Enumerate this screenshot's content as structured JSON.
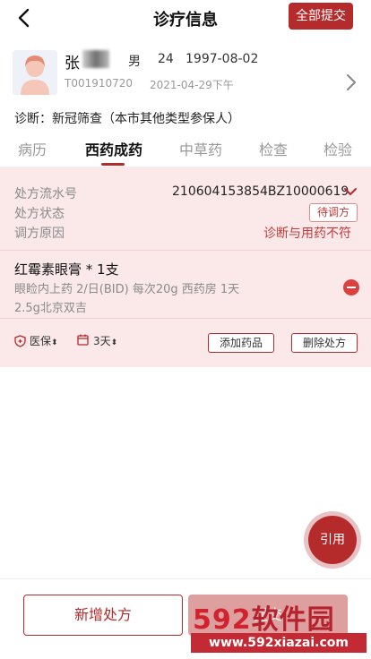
{
  "header": {
    "title": "诊疗信息",
    "submit_all_label": "全部提交"
  },
  "patient": {
    "name": "张",
    "gender": "男",
    "age": "24",
    "birthdate": "1997-08-02",
    "patient_id": "T001910720",
    "visit_time": "2021-04-29下午"
  },
  "diagnosis": {
    "text": "诊断：新冠筛查（本市其他类型参保人）"
  },
  "tabs": [
    {
      "label": "病历"
    },
    {
      "label": "西药成药"
    },
    {
      "label": "中草药"
    },
    {
      "label": "检查"
    },
    {
      "label": "检验"
    }
  ],
  "active_tab": "西药成药",
  "prescription": {
    "serial_label": "处方流水号",
    "serial_value": "210604153854BZ10000619",
    "status_label": "处方状态",
    "status_value": "待调方",
    "reason_label": "调方原因",
    "reason_value": "诊断与用药不符",
    "drug": {
      "name": "红霉素眼膏 * 1支",
      "detail_line1": "眼睑内上药 2/日(BID) 每次20g 西药房 1天",
      "detail_line2": "2.5g北京双吉"
    },
    "insurance_label": "医保",
    "days_label": "3天",
    "add_drug_label": "添加药品",
    "delete_rx_label": "删除处方"
  },
  "fab": {
    "label": "引用"
  },
  "bottom": {
    "add_rx_label": "新增处方",
    "submit_rx_label": "提交"
  },
  "watermark": {
    "logo_num": "592",
    "logo_text": "软件园",
    "url": "www.592xiazai.com"
  },
  "colors": {
    "accent": "#b52a2a",
    "card_bg": "#fbe9ea",
    "warning_text": "#c03a3a"
  },
  "icons": [
    "back-arrow-icon",
    "chevron-right-icon",
    "chevron-down-icon",
    "shield-icon",
    "calendar-icon",
    "minus-circle-icon",
    "sort-icon"
  ]
}
